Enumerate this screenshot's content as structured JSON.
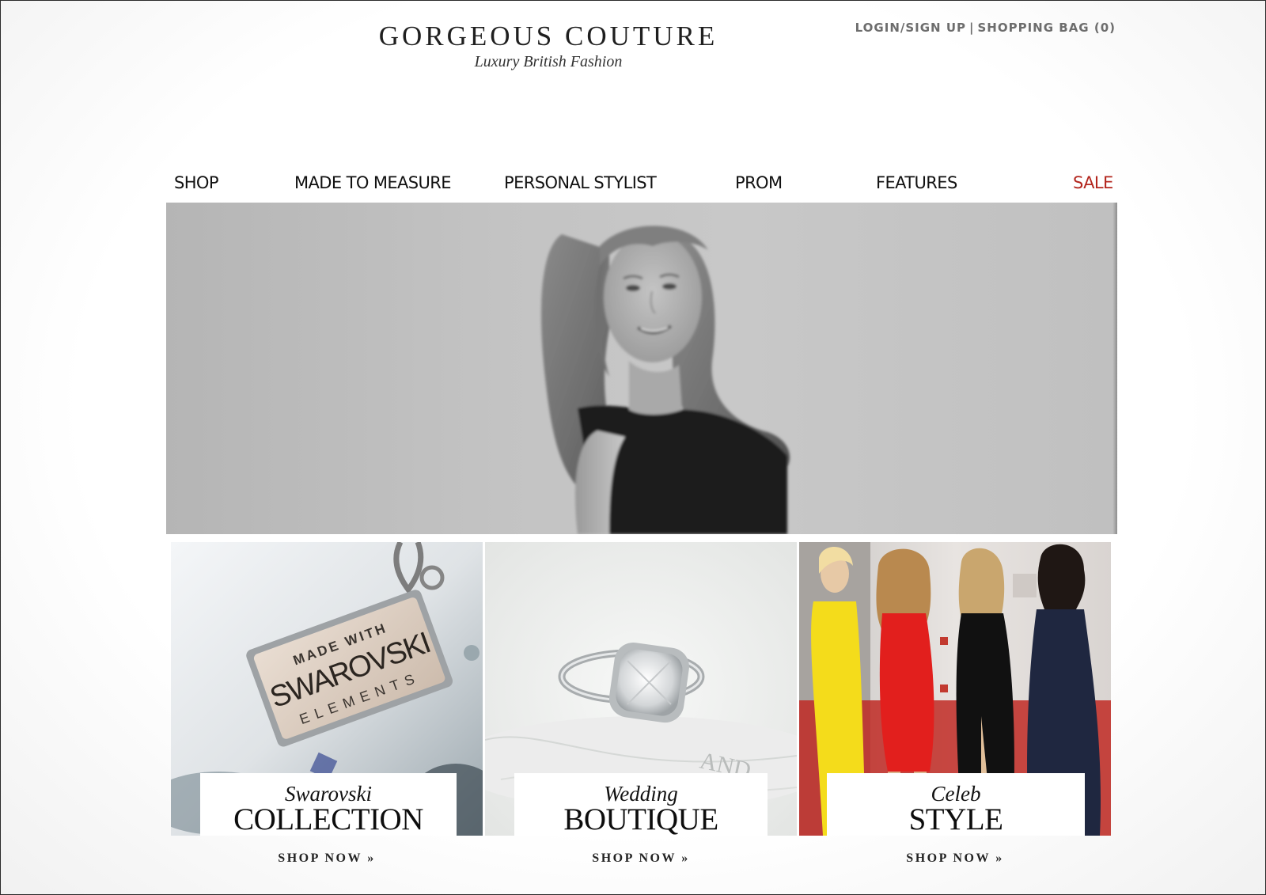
{
  "header": {
    "brand_name": "GORGEOUS COUTURE",
    "tagline": "Luxury British Fashion",
    "login_label": "LOGIN/SIGN UP",
    "separator": "|",
    "bag_label": "SHOPPING BAG (0)"
  },
  "nav": {
    "items": [
      {
        "label": "SHOP"
      },
      {
        "label": "MADE TO MEASURE"
      },
      {
        "label": "PERSONAL STYLIST"
      },
      {
        "label": "PROM"
      },
      {
        "label": "FEATURES"
      },
      {
        "label": "SALE"
      }
    ],
    "sale_color": "#b3261e"
  },
  "tiles": [
    {
      "script": "Swarovski",
      "heading": "COLLECTION",
      "cta": "SHOP NOW »",
      "image_text": {
        "line1": "MADE WITH",
        "line2": "SWAROVSKI",
        "line3": "ELEMENTS"
      }
    },
    {
      "script": "Wedding",
      "heading": "BOUTIQUE",
      "cta": "SHOP NOW »",
      "image_text": {
        "line1": "AND"
      }
    },
    {
      "script": "Celeb",
      "heading": "STYLE",
      "cta": "SHOP NOW »"
    }
  ],
  "icons": {
    "hero": "model-portrait-image",
    "tile_1": "swarovski-pendant-image",
    "tile_2": "diamond-ring-image",
    "tile_3": "celebrity-dresses-image"
  }
}
